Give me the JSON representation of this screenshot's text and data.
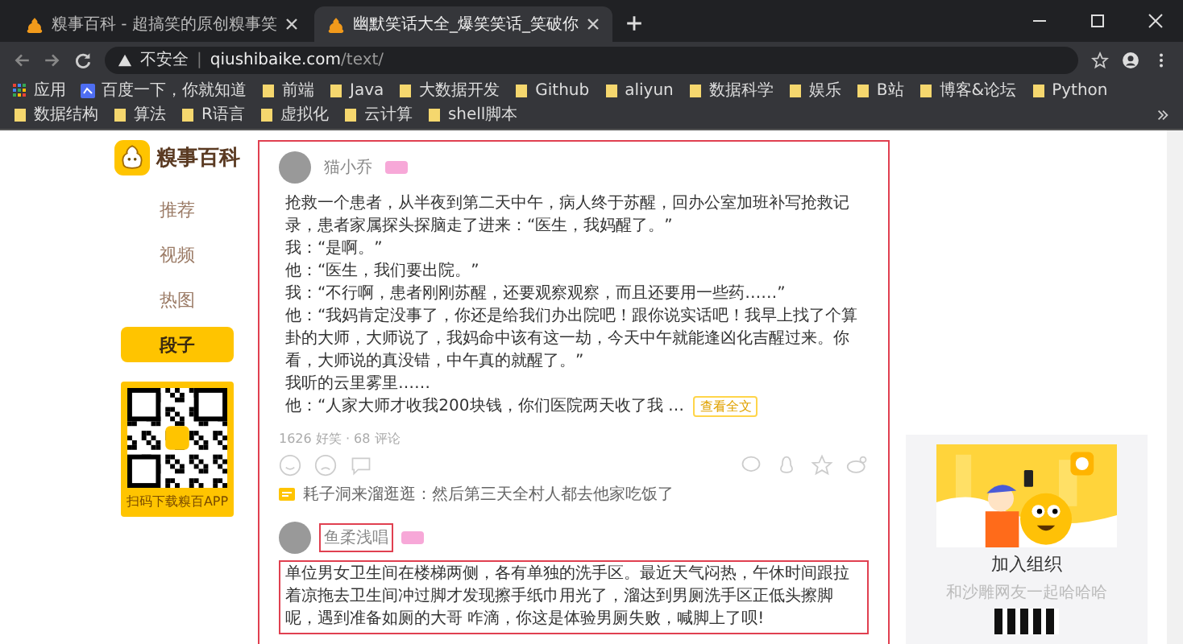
{
  "browser": {
    "tabs": [
      {
        "title": "糗事百科 - 超搞笑的原创糗事笑",
        "selected": false
      },
      {
        "title": "幽默笑话大全_爆笑笑话_笑破你",
        "selected": true
      }
    ],
    "url": {
      "security": "不安全",
      "separator": "|",
      "host": "qiushibaike.com",
      "path": "/text/"
    },
    "bookmarks": [
      {
        "label": "应用",
        "kind": "apps"
      },
      {
        "label": "百度一下，你就知道",
        "kind": "site"
      },
      {
        "label": "前端",
        "kind": "folder"
      },
      {
        "label": "Java",
        "kind": "folder"
      },
      {
        "label": "大数据开发",
        "kind": "folder"
      },
      {
        "label": "Github",
        "kind": "folder"
      },
      {
        "label": "aliyun",
        "kind": "folder"
      },
      {
        "label": "数据科学",
        "kind": "folder"
      },
      {
        "label": "娱乐",
        "kind": "folder"
      },
      {
        "label": "B站",
        "kind": "folder"
      },
      {
        "label": "博客&论坛",
        "kind": "folder"
      },
      {
        "label": "Python",
        "kind": "folder"
      },
      {
        "label": "数据结构",
        "kind": "folder"
      },
      {
        "label": "算法",
        "kind": "folder"
      },
      {
        "label": "R语言",
        "kind": "folder"
      },
      {
        "label": "虚拟化",
        "kind": "folder"
      },
      {
        "label": "云计算",
        "kind": "folder"
      },
      {
        "label": "shell脚本",
        "kind": "folder"
      }
    ]
  },
  "sidebar": {
    "logo_text": "糗事百科",
    "nav": [
      {
        "label": "推荐",
        "selected": false
      },
      {
        "label": "视频",
        "selected": false
      },
      {
        "label": "热图",
        "selected": false
      },
      {
        "label": "段子",
        "selected": true
      }
    ],
    "qr_caption": "扫码下载糗百APP"
  },
  "feed": {
    "outlined": true,
    "posts": [
      {
        "username": "猫小乔",
        "username_outlined": false,
        "text_outlined": false,
        "paragraphs": [
          "抢救一个患者，从半夜到第二天中午，病人终于苏醒，回办公室加班补写抢救记录，患者家属探头探脑走了进来：“医生，我妈醒了。”",
          "我：“是啊。”",
          "他：“医生，我们要出院。”",
          "我：“不行啊，患者刚刚苏醒，还要观察观察，而且还要用一些药……”",
          "他：“我妈肯定没事了，你还是给我们办出院吧！跟你说实话吧！我早上找了个算卦的大师，大师说了，我妈命中该有这一劫，今天中午就能逢凶化吉醒过来。你看，大师说的真没错，中午真的就醒了。”",
          "我听的云里雾里……",
          "他：“人家大师才收我200块钱，你们医院两天收了我 …"
        ],
        "more_button": "查看全文",
        "stats": "1626 好笑 · 68 评论",
        "comment": {
          "text": "耗子洞来溜逛逛：然后第三天全村人都去他家吃饭了"
        }
      },
      {
        "username": "鱼柔浅唱",
        "username_outlined": true,
        "text_outlined": true,
        "paragraphs": [
          "单位男女卫生间在楼梯两侧，各有单独的洗手区。最近天气闷热，午休时间跟拉着凉拖去卫生间冲过脚才发现擦手纸巾用光了，溜达到男厕洗手区正低头擦脚呢，遇到准备如厕的大哥 咋滴，你这是体验男厕失败，喊脚上了呗!"
        ]
      }
    ]
  },
  "promo": {
    "title": "加入组织",
    "subtitle": "和沙雕网友一起哈哈哈"
  }
}
